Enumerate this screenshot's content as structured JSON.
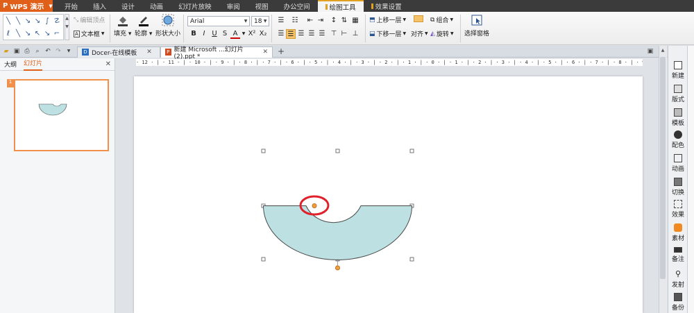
{
  "app": {
    "name": "WPS 演示",
    "logo": "P"
  },
  "menu": [
    "开始",
    "插入",
    "设计",
    "动画",
    "幻灯片放映",
    "审阅",
    "视图",
    "办公空间",
    "绘图工具",
    "效果设置"
  ],
  "ribbon": {
    "edit_points": "编辑顶点",
    "textbox": "文本框",
    "fill": "填充",
    "outline": "轮廓",
    "shape_size": "形状大小",
    "font_name": "Arial",
    "font_size": "18",
    "bring_forward": "上移一层",
    "send_backward": "下移一层",
    "group": "组合",
    "align": "对齐",
    "rotate": "旋转",
    "selection_pane": "选择窗格"
  },
  "tabs": [
    {
      "label": "Docer-在线模板"
    },
    {
      "label": "新建 Microsoft ...幻灯片 (2).ppt *"
    }
  ],
  "left_pane": {
    "outline_tab": "大纲",
    "slides_tab": "幻灯片",
    "slide_number": "1"
  },
  "ruler": "· 12 · | · 11 · | · 10 · | · 9 · | · 8 · | · 7 · | · 6 · | · 5 · | · 4 · | · 3 · | · 2 · | · 1 · | · 0 · | · 1 · | · 2 · | · 3 · | · 4 · | · 5 · | · 6 · | · 7 · | · 8 · | · 9 · | · 10 · | · 11 · | · 12 ·",
  "right_pane": [
    "新建",
    "版式",
    "模板",
    "配色",
    "动画",
    "切换",
    "效果",
    "素材",
    "备注",
    "发射",
    "备份"
  ],
  "colors": {
    "shape_fill": "#bde0e3",
    "shape_stroke": "#4a4a4a",
    "highlight_circle": "#e0202a",
    "accent": "#e0601a"
  }
}
